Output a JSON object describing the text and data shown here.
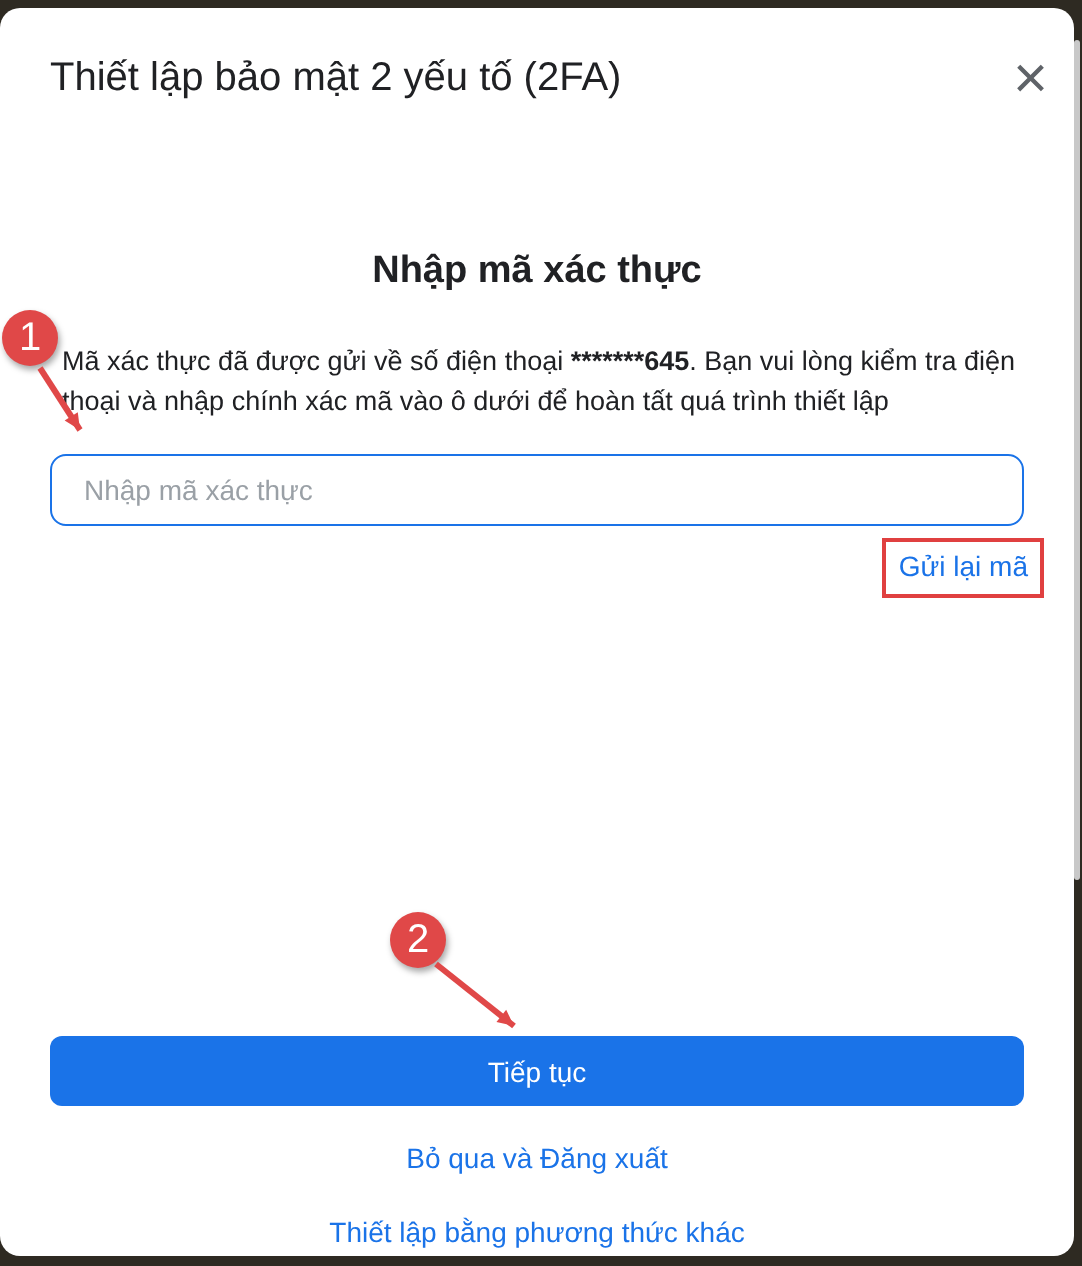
{
  "dialog": {
    "title": "Thiết lập bảo mật 2 yếu tố (2FA)",
    "close": "×"
  },
  "heading": "Nhập mã xác thực",
  "message": [
    {
      "text": "Mã xác thực đã được gửi về số điện thoại ",
      "bold": false
    },
    {
      "text": "*******645",
      "bold": true
    },
    {
      "text": ". Bạn vui lòng kiểm tra điện thoại và nhập chính xác mã vào ô dưới để hoàn tất quá trình thiết lập",
      "bold": false
    }
  ],
  "code_field": {
    "placeholder": "Nhập mã xác thực"
  },
  "resend_link": {
    "label": "Gửi lại mã",
    "highlighted": true
  },
  "continue_button": "Tiếp tục",
  "links": [
    "Bỏ qua và Đăng xuất",
    "Thiết lập bằng phương thức khác"
  ],
  "annotations": [
    {
      "label": "1"
    },
    {
      "label": "2"
    }
  ]
}
